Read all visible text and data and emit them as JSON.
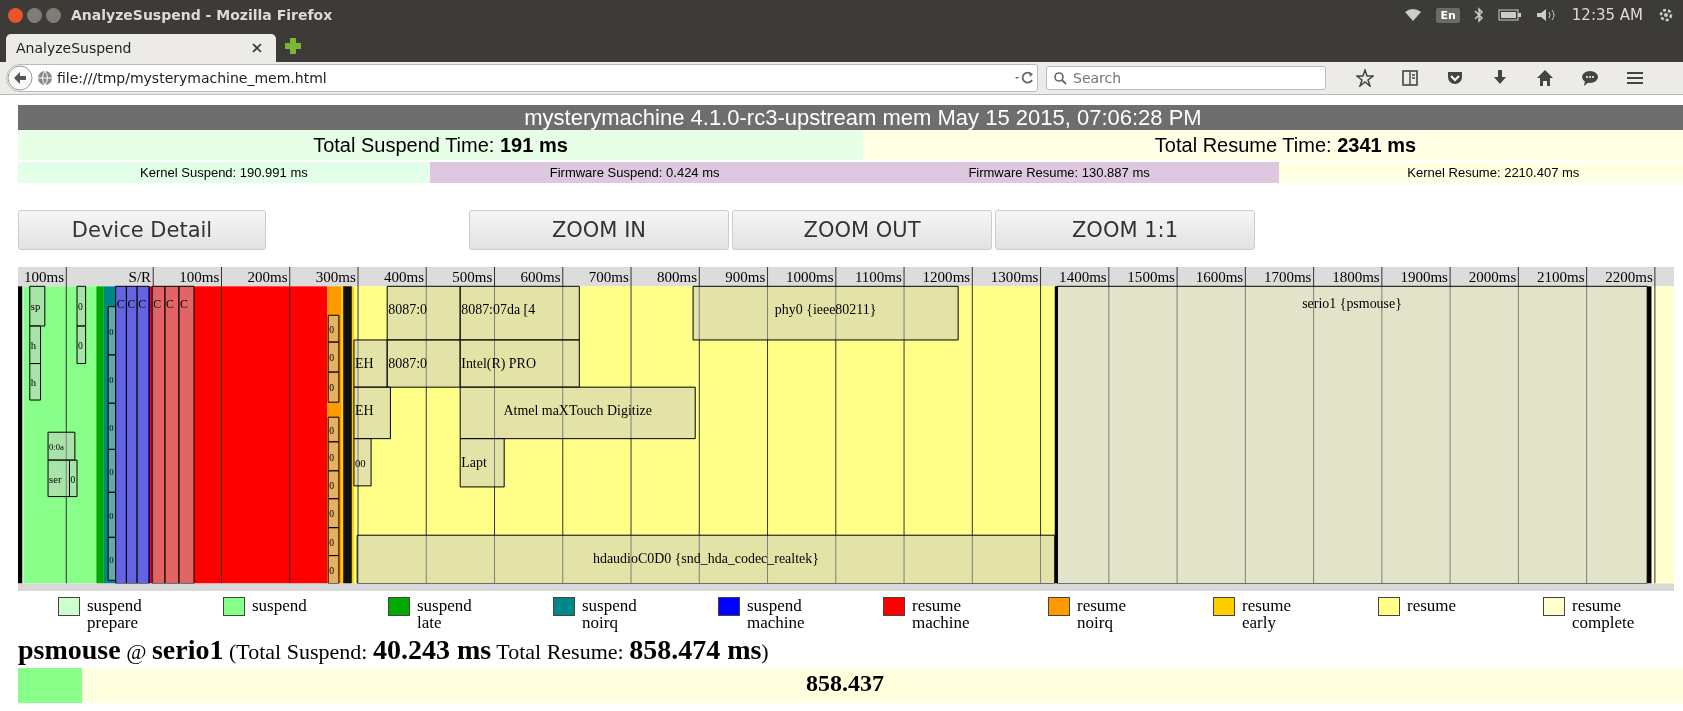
{
  "window": {
    "title": "AnalyzeSuspend - Mozilla Firefox"
  },
  "system_tray": {
    "keyboard": "En",
    "clock": "12:35 AM"
  },
  "tabs": [
    {
      "label": "AnalyzeSuspend",
      "selected": true
    }
  ],
  "address_bar": {
    "url": "file:///tmp/mysterymachine_mem.html"
  },
  "search": {
    "placeholder": "Search"
  },
  "page": {
    "header": "mysterymachine 4.1.0-rc3-upstream mem May 15 2015, 07:06:28 PM",
    "totals": [
      "Total Suspend Time: **191 ms**",
      "Total Resume Time: **2341 ms**"
    ],
    "phase_times": [
      "Kernel Suspend: 190.991 ms",
      "Firmware Suspend: 0.424 ms",
      "Firmware Resume: 130.887 ms",
      "Kernel Resume: 2210.407 ms"
    ],
    "buttons": [
      "Device Detail",
      "ZOOM IN",
      "ZOOM OUT",
      "ZOOM 1:1"
    ],
    "timeline": {
      "ticks": [
        "100ms",
        "S/R",
        "100ms",
        "200ms",
        "300ms",
        "400ms",
        "500ms",
        "600ms",
        "700ms",
        "800ms",
        "900ms",
        "1000ms",
        "1100ms",
        "1200ms",
        "1300ms",
        "1400ms",
        "1500ms",
        "1600ms",
        "1700ms",
        "1800ms",
        "1900ms",
        "2000ms",
        "2100ms",
        "2200ms"
      ],
      "devices": [
        {
          "label": "sp"
        },
        {
          "label": "h"
        },
        {
          "label": "h"
        },
        {
          "label": "0"
        },
        {
          "label": "0"
        },
        {
          "label": "0:0a"
        },
        {
          "label": "ser"
        },
        {
          "label": "0"
        },
        {
          "label": "0"
        },
        {
          "label": "0"
        },
        {
          "label": "0"
        },
        {
          "label": "0"
        },
        {
          "label": "0"
        },
        {
          "label": "0"
        },
        {
          "label": "C"
        },
        {
          "label": "C"
        },
        {
          "label": "C"
        },
        {
          "label": "C"
        },
        {
          "label": "C"
        },
        {
          "label": "C"
        },
        {
          "label": "0"
        },
        {
          "label": "0"
        },
        {
          "label": "0"
        },
        {
          "label": "0"
        },
        {
          "label": "0"
        },
        {
          "label": "0"
        },
        {
          "label": "0"
        },
        {
          "label": "0"
        },
        {
          "label": "0"
        },
        {
          "label": "8087:0"
        },
        {
          "label": "8087:07da [4"
        },
        {
          "label": "EH"
        },
        {
          "label": "8087:0"
        },
        {
          "label": "Intel(R) PRO"
        },
        {
          "label": "EH"
        },
        {
          "label": "Atmel maXTouch Digitize"
        },
        {
          "label": "00"
        },
        {
          "label": "Lapt"
        },
        {
          "label": "phy0 {ieee80211}"
        },
        {
          "label": "hdaudioC0D0 {snd_hda_codec_realtek}"
        },
        {
          "label": "serio1 {psmouse}"
        }
      ]
    },
    "legend": [
      {
        "label": "suspend prepare",
        "color": "#ccffcc"
      },
      {
        "label": "suspend",
        "color": "#88ff88"
      },
      {
        "label": "suspend late",
        "color": "#00aa00"
      },
      {
        "label": "suspend noirq",
        "color": "#008888"
      },
      {
        "label": "suspend machine",
        "color": "#0000ff"
      },
      {
        "label": "resume machine",
        "color": "#ff0000"
      },
      {
        "label": "resume noirq",
        "color": "#ff9900"
      },
      {
        "label": "resume early",
        "color": "#ffcc00"
      },
      {
        "label": "resume",
        "color": "#ffff88"
      },
      {
        "label": "resume complete",
        "color": "#ffffcc"
      }
    ],
    "device_summary": "**psmouse** @ **serio1** (Total Suspend: **40.243 ms** Total Resume: **858.474 ms**)",
    "device_bar": {
      "value": "858.437"
    }
  }
}
